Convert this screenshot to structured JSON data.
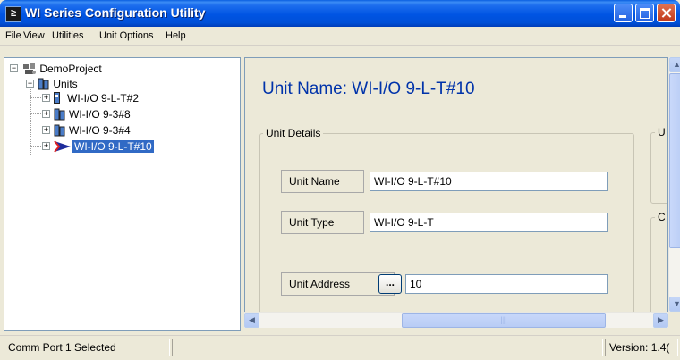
{
  "window": {
    "title": "WI Series Configuration Utility",
    "app_icon": "≥"
  },
  "menu": [
    {
      "label": "File"
    },
    {
      "label": "View"
    },
    {
      "label": "Utilities"
    },
    {
      "label": "Unit Options"
    },
    {
      "label": "Help"
    }
  ],
  "tree": {
    "root": "DemoProject",
    "folder": "Units",
    "units": [
      "WI-I/O 9-L-T#2",
      "WI-I/O 9-3#8",
      "WI-I/O 9-3#4",
      "WI-I/O 9-L-T#10"
    ],
    "selected_unit": "WI-I/O 9-L-T#10"
  },
  "main": {
    "heading": "Unit Name: WI-I/O 9-L-T#10",
    "unit_details_title": "Unit Details",
    "side_group_1_title": "U",
    "side_group_2_title": "C",
    "fields": {
      "unit_name": {
        "label": "Unit Name",
        "value": "WI-I/O 9-L-T#10"
      },
      "unit_type": {
        "label": "Unit Type",
        "value": "WI-I/O 9-L-T"
      },
      "unit_address": {
        "label": "Unit Address",
        "button": "...",
        "value": "10"
      }
    }
  },
  "status": {
    "left": "Comm Port 1 Selected",
    "middle": "",
    "right": "Version: 1.4("
  },
  "colors": {
    "accent": "#0054E3",
    "selection": "#316AC5",
    "heading": "#0033AA"
  }
}
